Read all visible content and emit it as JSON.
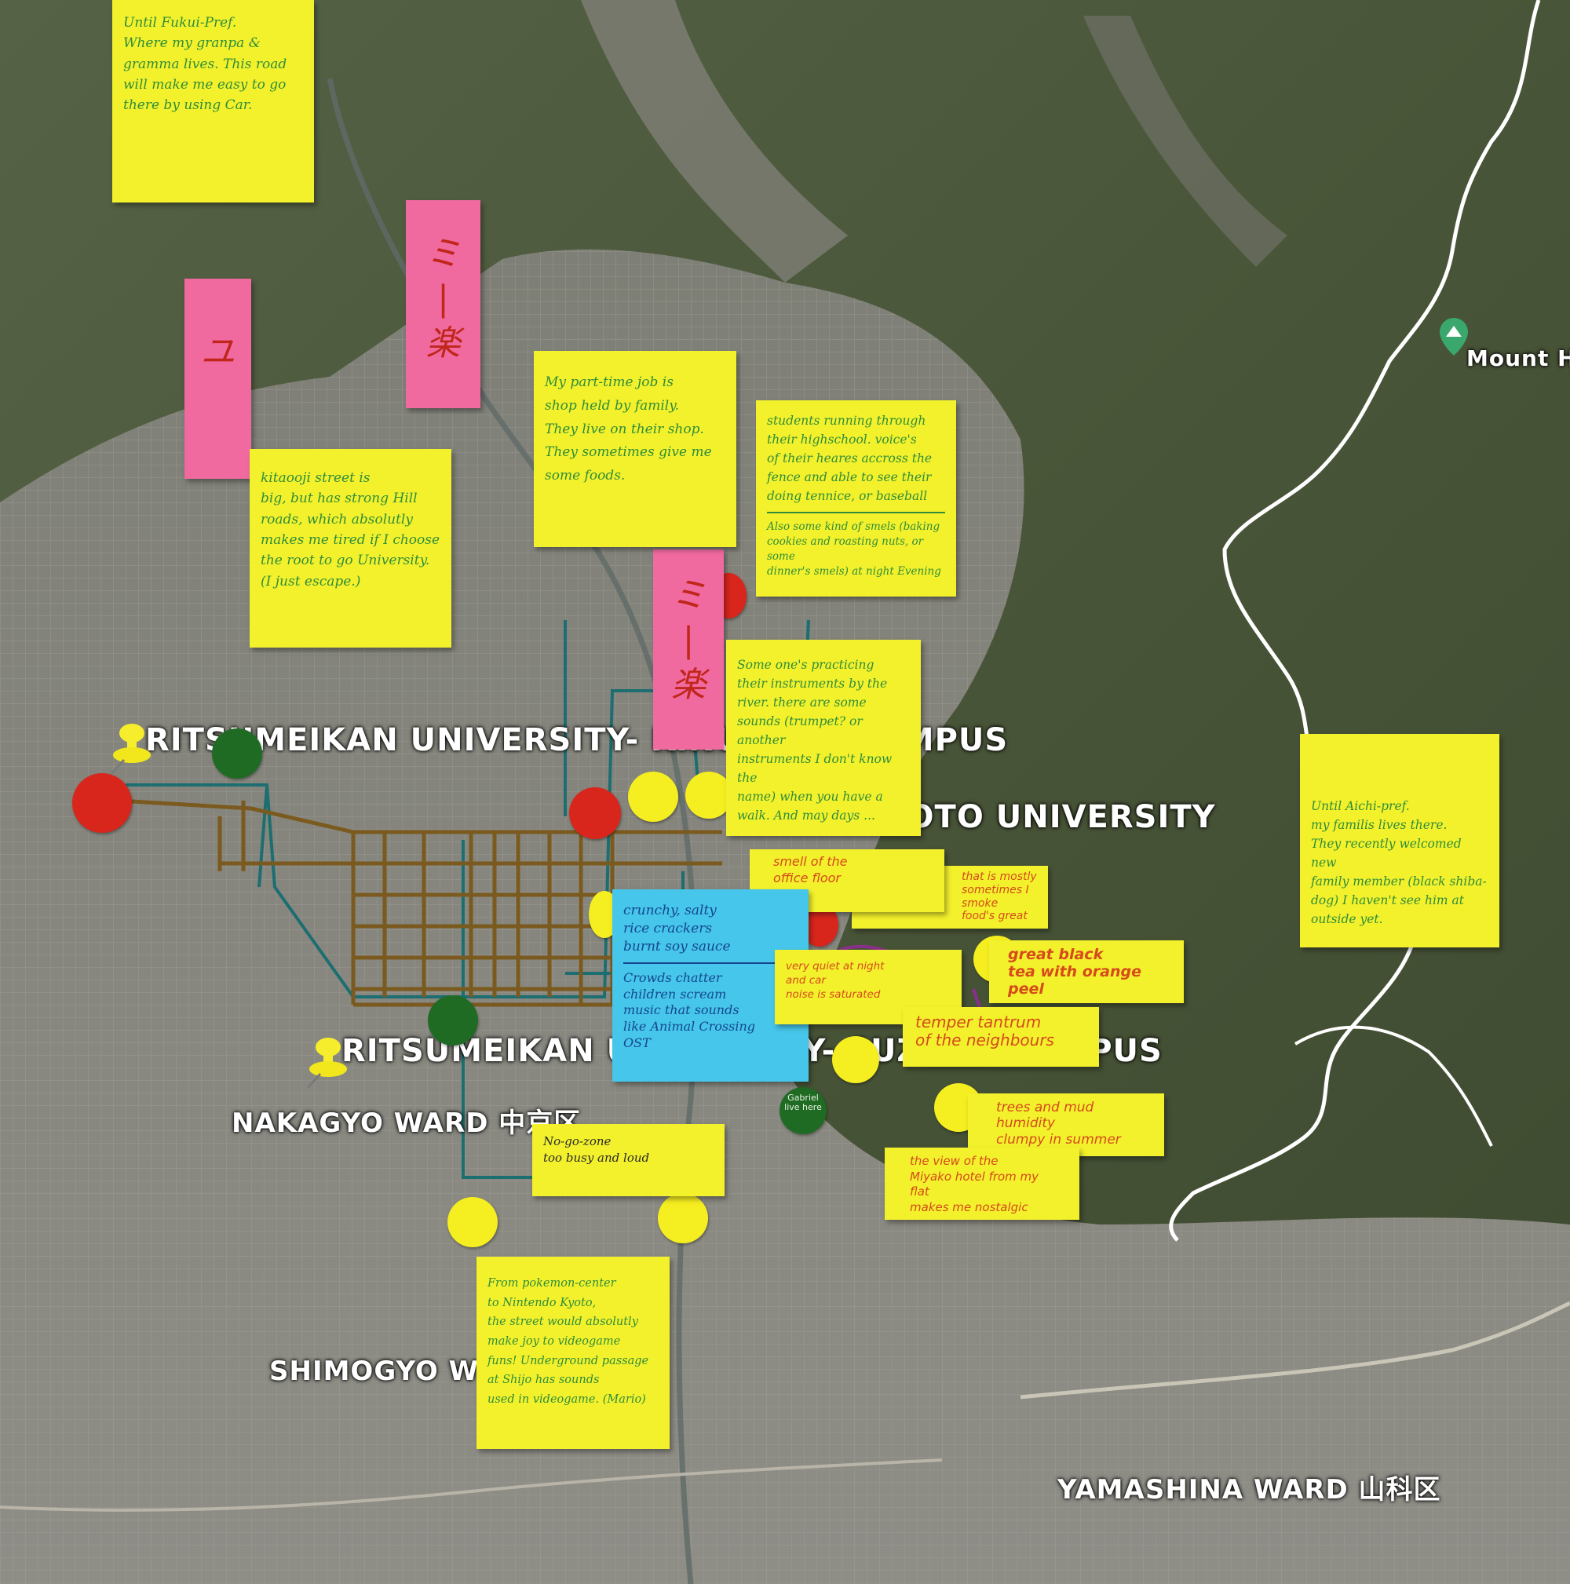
{
  "labels": {
    "ritsumeikan_kinugasa": "RITSUMEIKAN UNIVERSITY- KINUGASA CAMPUS",
    "kyoto_university": "KYOTO UNIVERSITY",
    "ritsumeikan_suzaku": "RITSUMEIKAN UNIVERSITY- SUZAKU CAMPUS",
    "nakagyo": "NAKAGYO WARD 中京区",
    "shimogyo": "SHIMOGYO WARD",
    "yamashina": "YAMASHINA WARD 山科区",
    "mount": "Mount Hiei"
  },
  "notes": {
    "fukui": "Until Fukui-Pref.\nWhere my granpa &\ngramma lives. This road\nwill make me easy to go\nthere by using Car.",
    "kitaooji": "kitaooji street is\nbig, but has strong Hill\nroads, which absolutly\nmakes me tired if I choose\nthe root to go University.\n(I just escape.)",
    "parttime": "My part-time job is\nshop held by family.\nThey live on their shop.\nThey sometimes give me\nsome foods.",
    "students_a": "students running through\ntheir highschool. voice's\nof their heares accross the\nfence and able to see their\ndoing tennice, or baseball",
    "students_b": "Also some kind of smels (baking\ncookies and roasting nuts, or some\ndinner's smels) at night Evening",
    "instruments": "Some one's practicing\ntheir instruments by the\nriver. there are some\nsounds (trumpet? or another\ninstruments I don't know the\nname) when you have a\nwalk. And may days ...",
    "aichi": "Until Aichi-pref.\nmy familis lives there.\nThey recently welcomed new\nfamily member (black shiba-\ndog) I haven't see him at\noutside yet.",
    "office_floor": "smell of the\noffice floor",
    "mostly": "that is mostly\nsometimes I\nsmoke\nfood's great",
    "crackers_a": "crunchy, salty\nrice crackers\nburnt soy sauce",
    "crackers_b": "Crowds chatter\nchildren scream\nmusic that sounds\nlike Animal Crossing\nOST",
    "quiet_night": "very quiet at night\nand car\nnoise is saturated",
    "black_tea": "great black\ntea with orange\npeel",
    "tantrum": "temper tantrum\nof the neighbours",
    "trees": "trees and mud\nhumidity\nclumpy in summer",
    "miyako": "the view of the\nMiyako hotel from my flat\nmakes me nostalgic",
    "no_go": "No-go-zone\ntoo busy and loud",
    "pokemon": "From pokemon-center\nto Nintendo Kyoto,\nthe street would absolutly\nmake joy to videogame\nfuns! Underground passage\nat Shijo has sounds\nused in videogame. (Mario)",
    "pink_1": "ユ",
    "pink_2": "ミ\n|\n楽",
    "pink_3": "ミ\n|\n楽"
  },
  "dot_labels": {
    "green_small": "Gabriel\nlive\nhere"
  },
  "colors": {
    "note_yellow": "#f3f12c",
    "note_pink": "#f06aa0",
    "note_blue": "#45c6ea",
    "dot_red": "#d9261c",
    "dot_yellow": "#f5ee20",
    "dot_green": "#1f6b24",
    "route_brown": "#7a5a1e",
    "route_teal": "#1c6e70",
    "trail_white": "#ffffff"
  }
}
